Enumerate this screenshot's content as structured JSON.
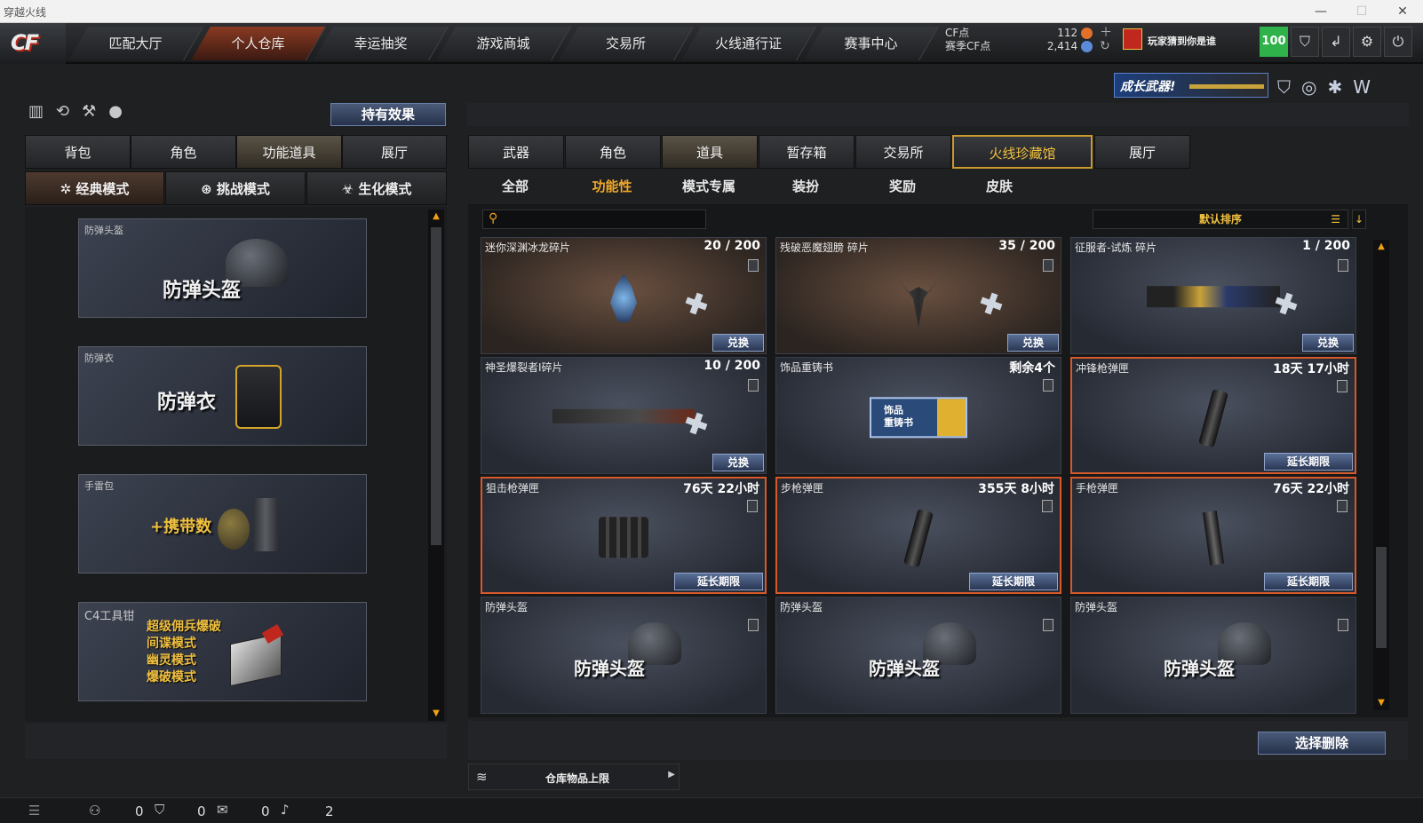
{
  "window": {
    "title": "穿越火线"
  },
  "nav": {
    "tabs": [
      "匹配大厅",
      "个人仓库",
      "幸运抽奖",
      "游戏商城",
      "交易所",
      "火线通行证",
      "赛事中心"
    ],
    "active_index": 1,
    "cf_label": "CF点",
    "cf_value": "112",
    "season_cf_label": "赛季CF点",
    "season_cf_value": "2,414",
    "player_text": "玩家猜到你是谁",
    "level": "100"
  },
  "left": {
    "effects_button": "持有效果",
    "tabs": [
      "背包",
      "角色",
      "功能道具",
      "展厅"
    ],
    "active_tab": 2,
    "modes": [
      "经典模式",
      "挑战模式",
      "生化模式"
    ],
    "active_mode": 0,
    "cards": [
      {
        "name": "防弹头盔",
        "big": "防弹头盔"
      },
      {
        "name": "防弹衣",
        "big": "防弹衣"
      },
      {
        "name": "手雷包",
        "big": "+携带数"
      },
      {
        "name": "C4工具钳",
        "lines": [
          "超级佣兵爆破",
          "间谍模式",
          "幽灵模式",
          "爆破模式"
        ]
      }
    ]
  },
  "right": {
    "banner_text": "成长武器!",
    "tabs": [
      "武器",
      "角色",
      "道具",
      "暂存箱",
      "交易所",
      "火线珍藏馆",
      "展厅"
    ],
    "active_tab": 2,
    "subtabs": [
      "全部",
      "功能性",
      "模式专属",
      "装扮",
      "奖励",
      "皮肤"
    ],
    "active_subtab": 1,
    "search_placeholder": "",
    "sort_label": "默认排序",
    "items": [
      {
        "name": "迷你深渊冰龙碎片",
        "count": "20 / 200",
        "action": "兑换",
        "style": "brown"
      },
      {
        "name": "残破恶魔翅膀 碎片",
        "count": "35 / 200",
        "action": "兑换",
        "style": "brown"
      },
      {
        "name": "征服者-试炼 碎片",
        "count": "1 / 200",
        "action": "兑换",
        "style": "blue"
      },
      {
        "name": "神圣爆裂者I碎片",
        "count": "10 / 200",
        "action": "兑换",
        "style": "blue"
      },
      {
        "name": "饰品重铸书",
        "count": "剩余4个",
        "action": "",
        "style": "blue",
        "card_text": [
          "饰品",
          "重铸书"
        ]
      },
      {
        "name": "冲锋枪弹匣",
        "count": "18天 17小时",
        "action": "延长期限",
        "style": "expiring"
      },
      {
        "name": "狙击枪弹匣",
        "count": "76天 22小时",
        "action": "延长期限",
        "style": "expiring"
      },
      {
        "name": "步枪弹匣",
        "count": "355天 8小时",
        "action": "延长期限",
        "style": "expiring"
      },
      {
        "name": "手枪弹匣",
        "count": "76天 22小时",
        "action": "延长期限",
        "style": "expiring"
      },
      {
        "name": "防弹头盔",
        "count": "",
        "action": "",
        "style": "blue",
        "big": "防弹头盔"
      },
      {
        "name": "防弹头盔",
        "count": "",
        "action": "",
        "style": "blue",
        "big": "防弹头盔"
      },
      {
        "name": "防弹头盔",
        "count": "",
        "action": "",
        "style": "blue",
        "big": "防弹头盔"
      }
    ],
    "select_delete_button": "选择删除",
    "capacity_label": "仓库物品上限"
  },
  "statusbar": {
    "counts": [
      "0",
      "0",
      "0",
      "2"
    ]
  }
}
